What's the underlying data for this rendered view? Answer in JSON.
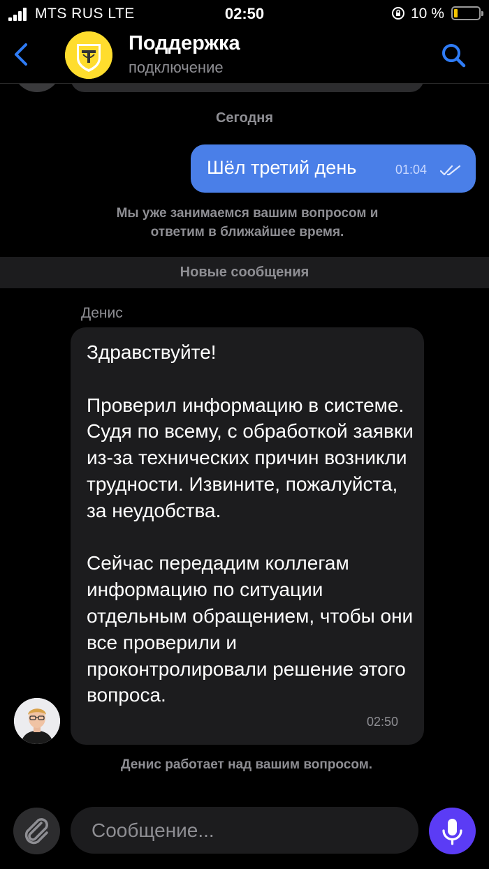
{
  "status_bar": {
    "carrier": "MTS RUS  LTE",
    "time": "02:50",
    "battery_percent": "10 %",
    "battery_level": 0.1,
    "battery_color": "#f5c400"
  },
  "header": {
    "title": "Поддержка",
    "subtitle": "подключение",
    "back_icon": "chevron-left-icon",
    "search_icon": "search-icon",
    "accent_color": "#2f7cf6"
  },
  "chat": {
    "date_separator": "Сегодня",
    "outgoing": {
      "text": "Шёл третий день",
      "time": "01:04",
      "status_icon": "double-check-icon",
      "bubble_color": "#4a7fe8"
    },
    "system_message": {
      "line1": "Мы уже занимаемся вашим вопросом и",
      "line2": "ответим в ближайшее время."
    },
    "new_messages_label": "Новые сообщения",
    "incoming": {
      "sender": "Денис",
      "paragraphs": [
        "Здравствуйте!",
        "Проверил информацию в системе. Судя по всему, с обработкой заявки из-за технических причин возникли трудности. Извините, пожалуйста, за неудобства.",
        "Сейчас передадим коллегам информацию по ситуации отдельным обращением, чтобы они все проверили и проконтролировали решение этого вопроса."
      ],
      "time": "02:50"
    },
    "working_status": "Денис работает над вашим вопросом."
  },
  "composer": {
    "placeholder": "Сообщение...",
    "attach_icon": "paperclip-icon",
    "mic_icon": "microphone-icon",
    "mic_color": "#5b3cf5"
  }
}
